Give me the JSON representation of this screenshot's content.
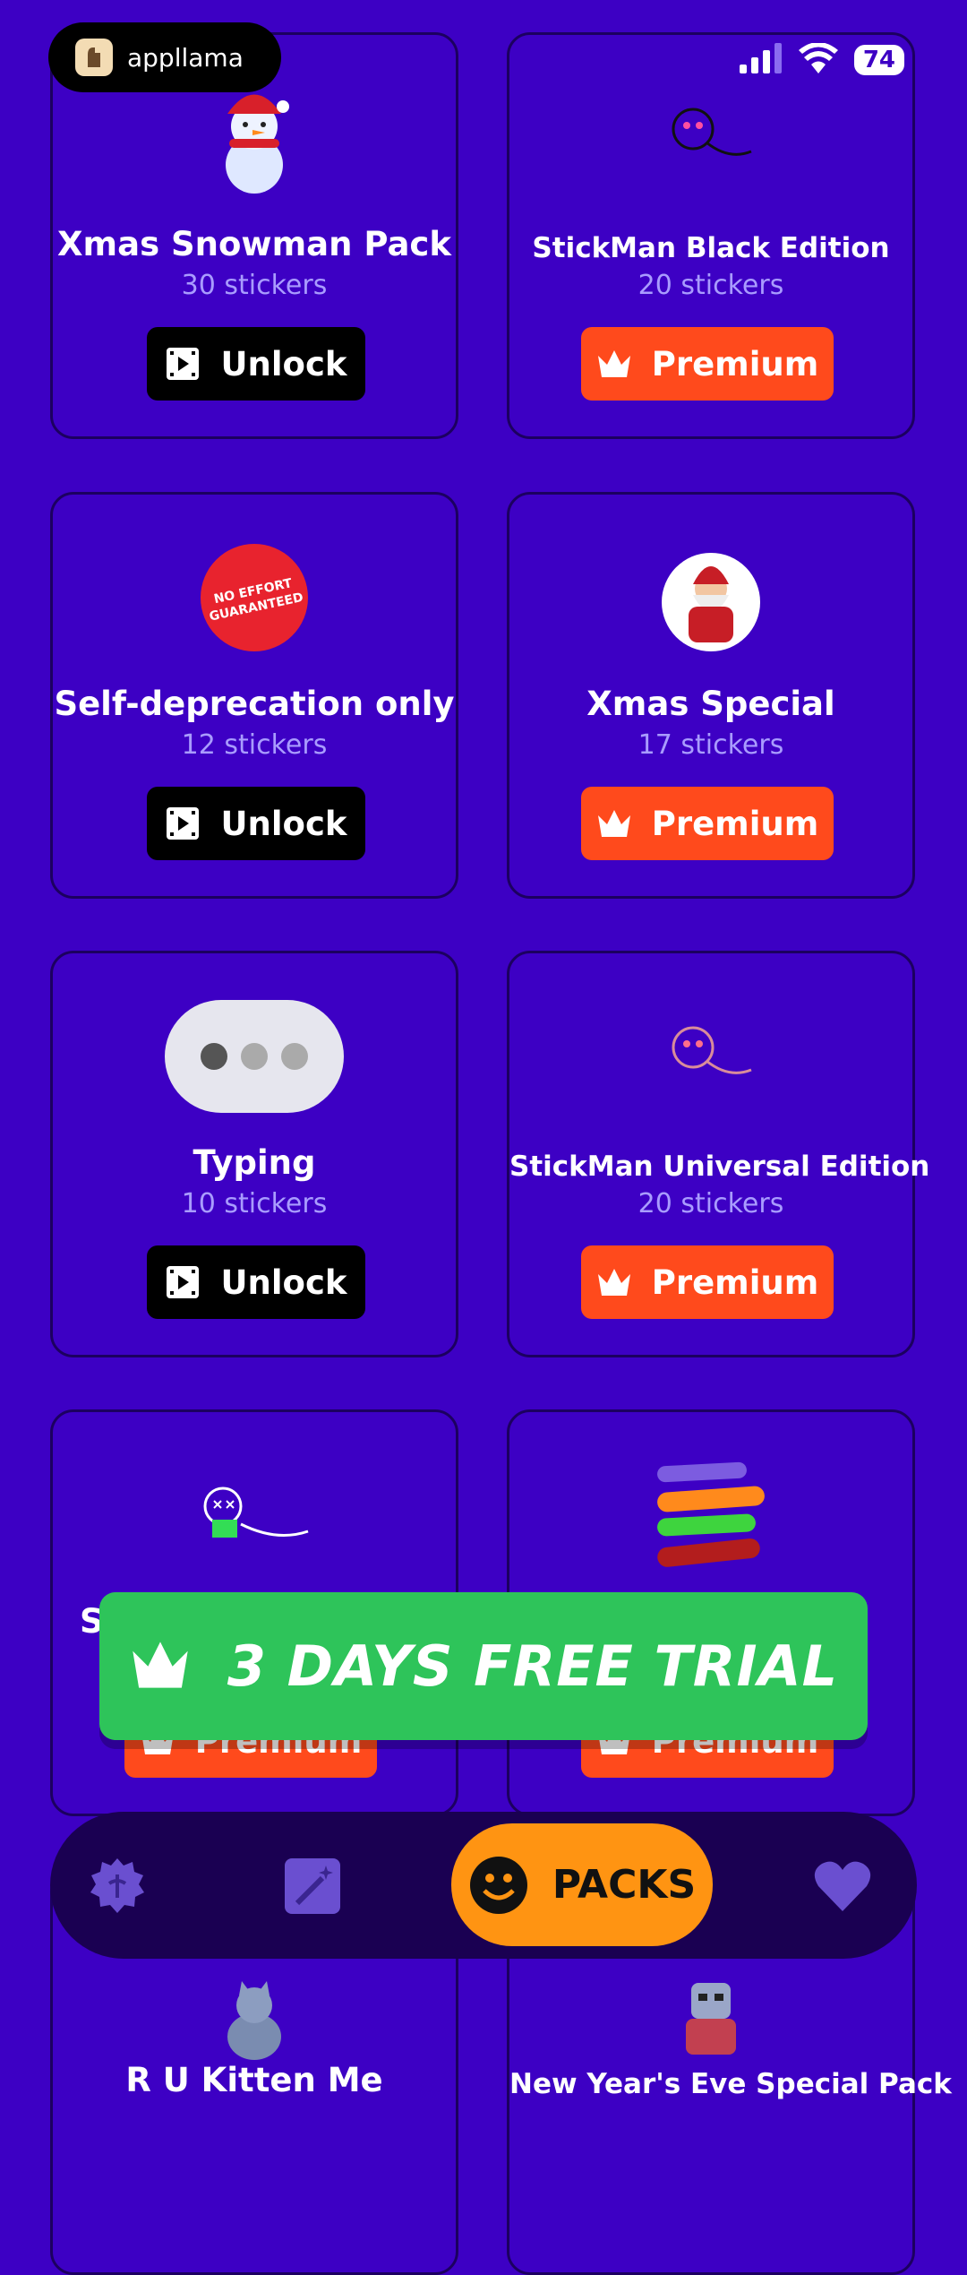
{
  "status_bar": {
    "app_name": "appllama",
    "battery": "74"
  },
  "packs": [
    {
      "title": "Xmas Snowman Pack",
      "count": "30 stickers",
      "action": "Unlock",
      "type": "unlock"
    },
    {
      "title": "StickMan Black Edition",
      "count": "20 stickers",
      "action": "Premium",
      "type": "premium"
    },
    {
      "title": "Self-deprecation only",
      "count": "12 stickers",
      "action": "Unlock",
      "type": "unlock",
      "sticker_text": "NO EFFORT GUARANTEED"
    },
    {
      "title": "Xmas Special",
      "count": "17 stickers",
      "action": "Premium",
      "type": "premium"
    },
    {
      "title": "Typing",
      "count": "10 stickers",
      "action": "Unlock",
      "type": "unlock"
    },
    {
      "title": "StickMan Universal Edition",
      "count": "20 stickers",
      "action": "Premium",
      "type": "premium"
    },
    {
      "title": "St",
      "count": "",
      "action": "Premium",
      "type": "premium"
    },
    {
      "title": "",
      "count": "",
      "action": "Premium",
      "type": "premium"
    },
    {
      "title": "R U Kitten Me",
      "count": "",
      "action": "",
      "type": ""
    },
    {
      "title": "New Year's Eve Special Pack",
      "count": "",
      "action": "",
      "type": ""
    }
  ],
  "trial_banner": {
    "label": "3 DAYS FREE TRIAL"
  },
  "tabbar": {
    "active_label": "PACKS",
    "icons": [
      "badge-icon",
      "magic-wand-icon",
      "packs-icon",
      "heart-icon"
    ]
  },
  "colors": {
    "background": "#3d00c4",
    "premium": "#ff4a1c",
    "unlock": "#000000",
    "trial": "#2ec45a",
    "active_tab": "#ff9412"
  }
}
